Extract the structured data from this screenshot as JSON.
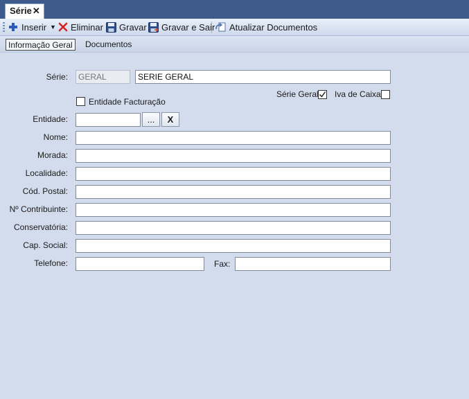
{
  "document_tab": {
    "title": "Série",
    "close": "✕"
  },
  "toolbar": {
    "insert": "Inserir",
    "delete": "Eliminar",
    "save": "Gravar",
    "save_exit": "Gravar e Sair",
    "update_docs": "Atualizar Documentos"
  },
  "tabs": {
    "general": "Informação Geral",
    "documents": "Documentos"
  },
  "form": {
    "serie_label": "Série:",
    "serie_code_placeholder": "GERAL",
    "serie_name_value": "SERIE GERAL",
    "serie_geral_label": "Série Geral",
    "serie_geral_checked": true,
    "iva_caixa_label": "Iva de Caixa",
    "iva_caixa_checked": false,
    "entidade_facturacao_label": "Entidade Facturação",
    "entidade_facturacao_checked": false,
    "entidade_label": "Entidade:",
    "entidade_value": "",
    "browse_label": "...",
    "clear_label": "X",
    "nome_label": "Nome:",
    "morada_label": "Morada:",
    "localidade_label": "Localidade:",
    "cod_postal_label": "Cód. Postal:",
    "contribuinte_label": "Nº Contribuinte:",
    "conservatoria_label": "Conservatória:",
    "cap_social_label": "Cap. Social:",
    "telefone_label": "Telefone:",
    "fax_label": "Fax:"
  },
  "colors": {
    "background": "#d3dcec",
    "tabstrip": "#3d5a8a",
    "delete_icon": "#d42020",
    "insert_icon": "#2a5bbd"
  }
}
